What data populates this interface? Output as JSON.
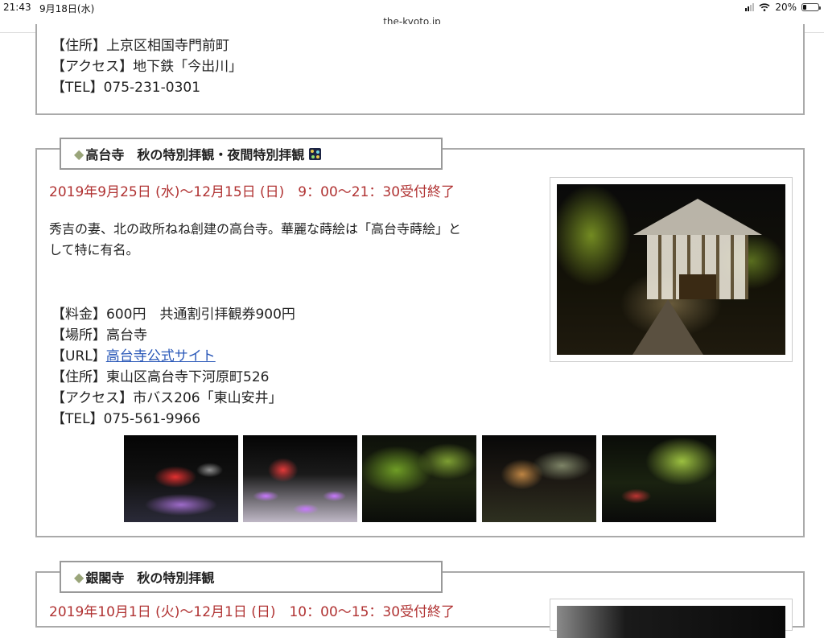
{
  "status_bar": {
    "time": "21:43",
    "date": "9月18日(水)",
    "battery": "20%",
    "battery_level": 0.2
  },
  "browser": {
    "url": "the-kyoto.jp"
  },
  "section_prev": {
    "address": "【住所】上京区相国寺門前町",
    "access": "【アクセス】地下鉄「今出川」",
    "tel": "【TEL】075-231-0301"
  },
  "section_kodaiji": {
    "title": "高台寺　秋の特別拝観・夜間特別拝観",
    "title_diamond": "◆",
    "dates": "2019年9月25日 (水)〜12月15日 (日)　9：00〜21：30受付終了",
    "description_line1": "秀吉の妻、北の政所ねね創建の高台寺。華麗な蒔絵は「高台寺蒔絵」と",
    "description_line2": "して特に有名。",
    "fee": "【料金】600円　共通割引拝観券900円",
    "place": "【場所】高台寺",
    "url_prefix": "【URL】",
    "url_link": "高台寺公式サイト",
    "address": "【住所】東山区高台寺下河原町526",
    "access": "【アクセス】市バス206「東山安井」",
    "tel": "【TEL】075-561-9966"
  },
  "section_ginkakuji": {
    "title": "銀閣寺　秋の特別拝観",
    "title_diamond": "◆",
    "dates": "2019年10月1日 (火)〜12月1日 (日)　10：00〜15：30受付終了"
  }
}
